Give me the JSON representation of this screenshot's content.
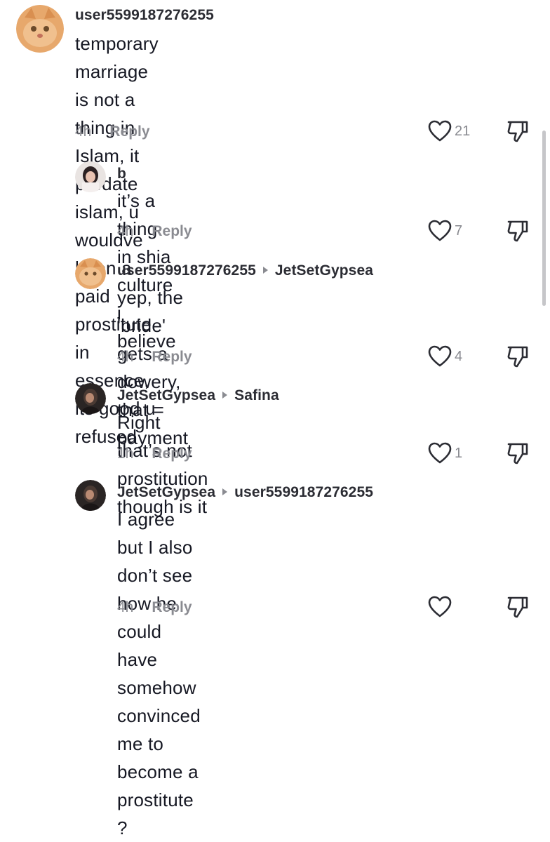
{
  "comments": [
    {
      "username": "user5599187276255",
      "reply_to": "",
      "lines": [
        "temporary marriage is not a thing in Islam, it",
        "predate islam, u wouldve been a paid prostitute",
        "in essence, its good u refused"
      ],
      "time": "4h",
      "reply_label": "Reply",
      "likes": "21",
      "avatar": "orange-cat-avatar"
    },
    {
      "username": "b",
      "reply_to": "",
      "lines": [
        "it’s a thing in shia culture i believe"
      ],
      "time": "4h",
      "reply_label": "Reply",
      "likes": "7",
      "avatar": "person-avatar"
    },
    {
      "username": "user5599187276255",
      "reply_to": "JetSetGypsea",
      "lines": [
        "yep, the 'bride' gets a dowery, that =",
        "payment"
      ],
      "time": "4h",
      "reply_label": "Reply",
      "likes": "4",
      "avatar": "orange-cat-avatar"
    },
    {
      "username": "JetSetGypsea",
      "reply_to": "Safina",
      "lines": [
        "Right that’s not prostitution though is it"
      ],
      "time": "1h",
      "reply_label": "Reply",
      "likes": "1",
      "avatar": "dark-hair-avatar"
    },
    {
      "username": "JetSetGypsea",
      "reply_to": "user5599187276255",
      "lines": [
        "I agree but I also don’t see how he could",
        "have somehow convinced me to become a",
        "prostitute ?"
      ],
      "time": "4h",
      "reply_label": "Reply",
      "likes": "",
      "avatar": "dark-hair-avatar"
    }
  ],
  "colors": {
    "text": "#161823",
    "muted": "#8a8b91",
    "username": "#2b2c33"
  }
}
